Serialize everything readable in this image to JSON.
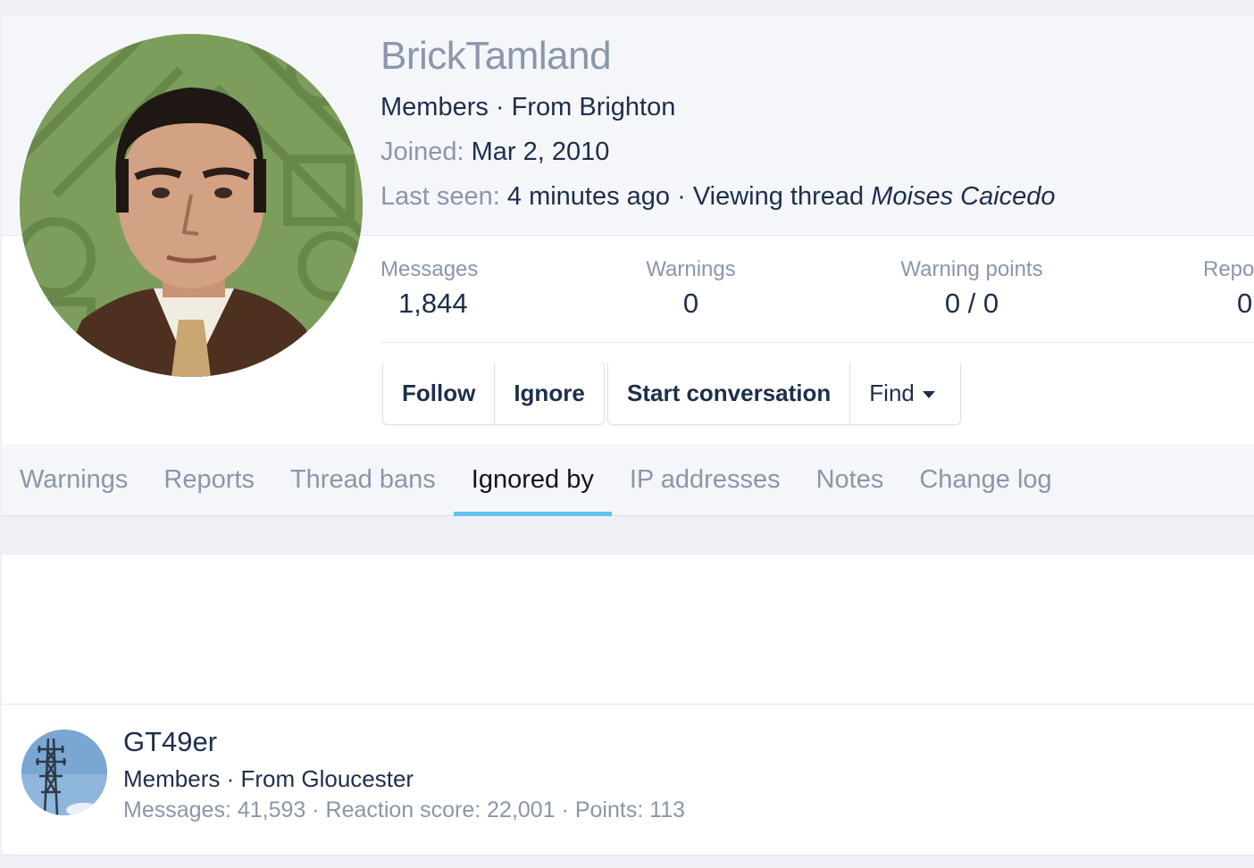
{
  "profile": {
    "username": "BrickTamland",
    "role": "Members",
    "from_sep": " · From ",
    "location": "Brighton",
    "joined_label": "Joined:",
    "joined_value": "Mar 2, 2010",
    "last_seen_label": "Last seen:",
    "last_seen_value": "4 minutes ago",
    "activity_text": " · Viewing thread ",
    "activity_thread": "Moises Caicedo"
  },
  "stats": [
    {
      "label": "Messages",
      "value": "1,844"
    },
    {
      "label": "Warnings",
      "value": "0"
    },
    {
      "label": "Warning points",
      "value": "0 / 0"
    },
    {
      "label": "Repo",
      "value": "0"
    }
  ],
  "buttons": {
    "follow": "Follow",
    "ignore": "Ignore",
    "start_conversation": "Start conversation",
    "find": "Find"
  },
  "tabs": [
    {
      "label": "Warnings",
      "active": false
    },
    {
      "label": "Reports",
      "active": false
    },
    {
      "label": "Thread bans",
      "active": false
    },
    {
      "label": "Ignored by",
      "active": true
    },
    {
      "label": "IP addresses",
      "active": false
    },
    {
      "label": "Notes",
      "active": false
    },
    {
      "label": "Change log",
      "active": false
    }
  ],
  "ignored_by": [
    {
      "name": "GT49er",
      "role": "Members",
      "from_sep": " · From ",
      "location": "Gloucester",
      "stats_text": "Messages: 41,593 · Reaction score: 22,001 · Points: 113"
    }
  ],
  "colors": {
    "accent_tab": "#5ec3ef",
    "muted_text": "#8a96aa",
    "primary_text": "#1d2e4d"
  }
}
